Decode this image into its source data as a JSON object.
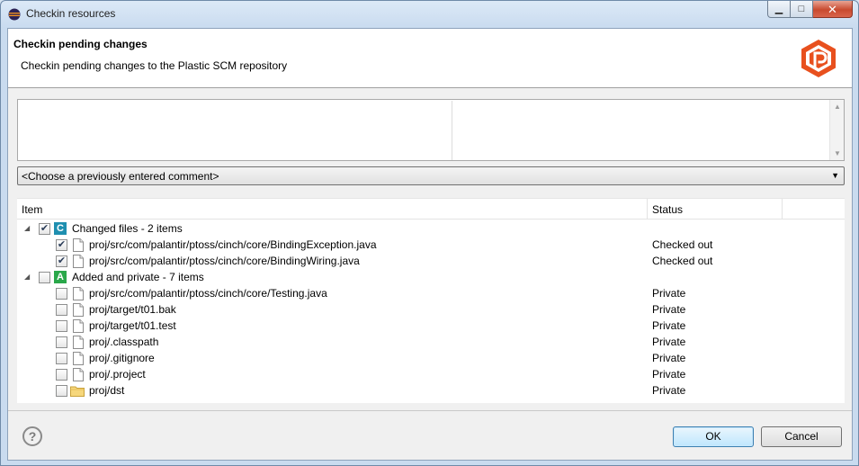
{
  "window": {
    "title": "Checkin resources"
  },
  "header": {
    "title": "Checkin pending changes",
    "description": "Checkin pending changes to the Plastic SCM repository"
  },
  "comment": {
    "value": "",
    "previous_placeholder": "<Choose a previously entered comment>"
  },
  "tree": {
    "columns": [
      "Item",
      "Status"
    ],
    "groups": [
      {
        "badge": "C",
        "badge_color": "#1f8fb0",
        "label": "Changed files - 2 items",
        "checked": true,
        "items": [
          {
            "name": "proj/src/com/palantir/ptoss/cinch/core/BindingException.java",
            "status": "Checked out",
            "checked": true,
            "type": "file"
          },
          {
            "name": "proj/src/com/palantir/ptoss/cinch/core/BindingWiring.java",
            "status": "Checked out",
            "checked": true,
            "type": "file"
          }
        ]
      },
      {
        "badge": "A",
        "badge_color": "#2aa84a",
        "label": "Added and private - 7 items",
        "checked": false,
        "items": [
          {
            "name": "proj/src/com/palantir/ptoss/cinch/core/Testing.java",
            "status": "Private",
            "checked": false,
            "type": "file"
          },
          {
            "name": "proj/target/t01.bak",
            "status": "Private",
            "checked": false,
            "type": "file"
          },
          {
            "name": "proj/target/t01.test",
            "status": "Private",
            "checked": false,
            "type": "file"
          },
          {
            "name": "proj/.classpath",
            "status": "Private",
            "checked": false,
            "type": "file"
          },
          {
            "name": "proj/.gitignore",
            "status": "Private",
            "checked": false,
            "type": "file"
          },
          {
            "name": "proj/.project",
            "status": "Private",
            "checked": false,
            "type": "file"
          },
          {
            "name": "proj/dst",
            "status": "Private",
            "checked": false,
            "type": "folder"
          }
        ]
      }
    ]
  },
  "buttons": {
    "ok": "OK",
    "cancel": "Cancel",
    "help": "?"
  },
  "colors": {
    "logo": "#e8501e",
    "accent": "#3c7fb1"
  },
  "icons": {
    "app": "eclipse-icon",
    "logo": "plastic-scm-logo",
    "file": "file-icon",
    "folder": "folder-icon",
    "help": "help-icon"
  }
}
